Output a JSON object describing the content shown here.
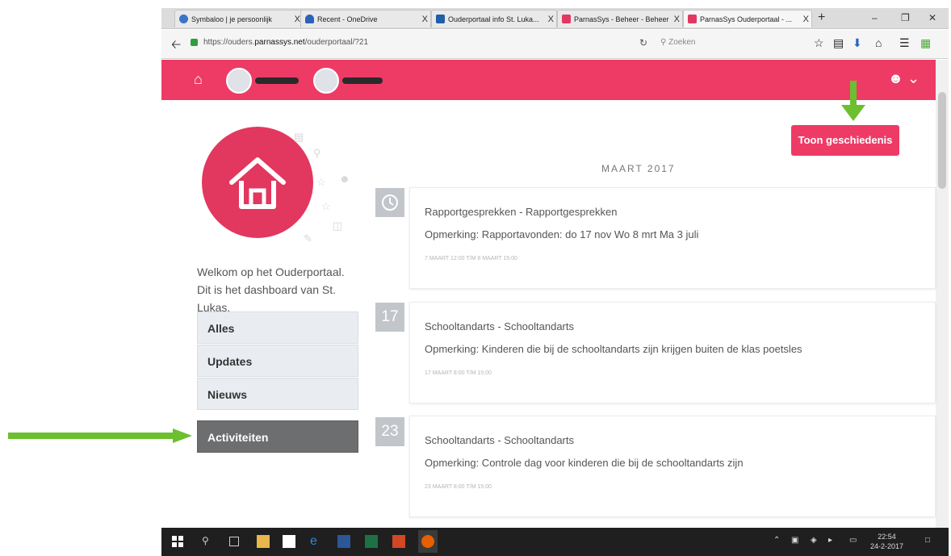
{
  "browser": {
    "tabs": [
      {
        "label": "Symbaloo | je persoonlijk",
        "color": "#3b73c8"
      },
      {
        "label": "Recent - OneDrive",
        "color": "#2a63b8"
      },
      {
        "label": "Ouderportaal info St. Luka...",
        "color": "#1e5fa8"
      },
      {
        "label": "ParnasSys - Beheer - Beheer",
        "color": "#e2375f"
      },
      {
        "label": "ParnasSys Ouderportaal - ...",
        "color": "#e2375f"
      }
    ],
    "new_tab": "+",
    "tab_close": "X",
    "url_prefix": "https://ouders.",
    "url_domain": "parnassys.net",
    "url_path": "/ouderportaal/?21",
    "search_placeholder": "Zoeken"
  },
  "header": {
    "color": "#ee3b66"
  },
  "sidebar": {
    "welcome": "Welkom op het Ouderportaal. Dit is het dashboard van St. Lukas.",
    "menu": [
      {
        "label": "Alles",
        "active": false
      },
      {
        "label": "Updates",
        "active": false
      },
      {
        "label": "Nieuws",
        "active": false
      },
      {
        "label": "Activiteiten",
        "active": true
      }
    ]
  },
  "history_button": "Toon geschiedenis",
  "timeline": {
    "month": "MAART 2017",
    "items": [
      {
        "badge_icon": "clock-icon",
        "title": "Rapportgesprekken - Rapportgesprekken",
        "note": "Opmerking: Rapportavonden: do 17 nov Wo 8 mrt Ma 3 juli",
        "date": "7 MAART 12:00 T/M 8 MAART 15:00"
      },
      {
        "badge": "17",
        "title": "Schooltandarts - Schooltandarts",
        "note": "Opmerking: Kinderen die bij de schooltandarts zijn krijgen buiten de klas poetsles",
        "date": "17 MAART 8:00 T/M 15:00"
      },
      {
        "badge": "23",
        "title": "Schooltandarts - Schooltandarts",
        "note": "Opmerking: Controle dag voor kinderen die bij de schooltandarts zijn",
        "date": "23 MAART 8:00 T/M 15:00"
      }
    ]
  },
  "taskbar": {
    "time": "22:54",
    "date": "24-2-2017"
  },
  "colors": {
    "brand": "#ee3b66",
    "arrow": "#6cbf2e",
    "active_menu": "#6d6e70"
  }
}
